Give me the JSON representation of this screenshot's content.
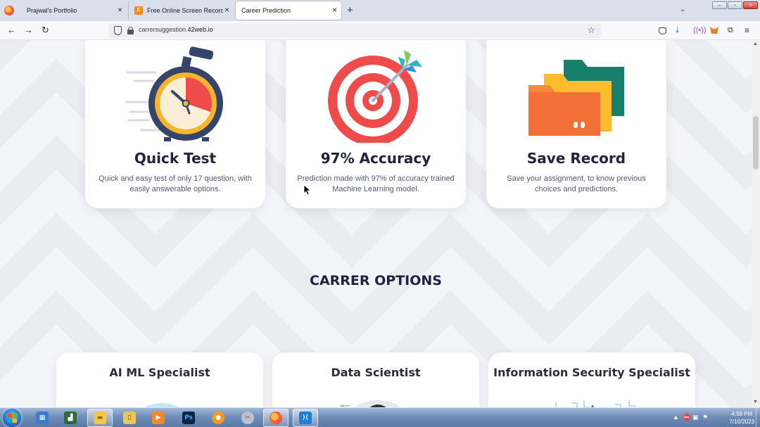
{
  "browser": {
    "tabs": [
      {
        "title": "Prajwal's Portfolio",
        "active": false
      },
      {
        "title": "Free Online Screen Recorder & Video Editor",
        "active": false
      },
      {
        "title": "Career Prediction",
        "active": true
      }
    ],
    "url_host": "carrersuggestion.",
    "url_domain": "42web.io"
  },
  "features": [
    {
      "title": "Quick Test",
      "description": "Quick and easy test of only 17 question, with easily answerable options.",
      "icon": "stopwatch-icon"
    },
    {
      "title": "97% Accuracy",
      "description": "Prediction made with 97% of accuracy trained Machine Learning model.",
      "icon": "target-icon"
    },
    {
      "title": "Save Record",
      "description": "Save your assignment, to know previous choices and predictions.",
      "icon": "folders-icon"
    }
  ],
  "career_section": {
    "title": "CARRER OPTIONS",
    "options": [
      {
        "title": "AI ML Specialist"
      },
      {
        "title": "Data Scientist"
      },
      {
        "title": "Information Security Specialist"
      }
    ]
  },
  "taskbar": {
    "time": "4:59 PM",
    "date": "7/10/2023"
  },
  "colors": {
    "heading": "#1e2340",
    "accent_red": "#ef4b4b",
    "accent_orange": "#f6893c",
    "accent_teal": "#17806d"
  }
}
